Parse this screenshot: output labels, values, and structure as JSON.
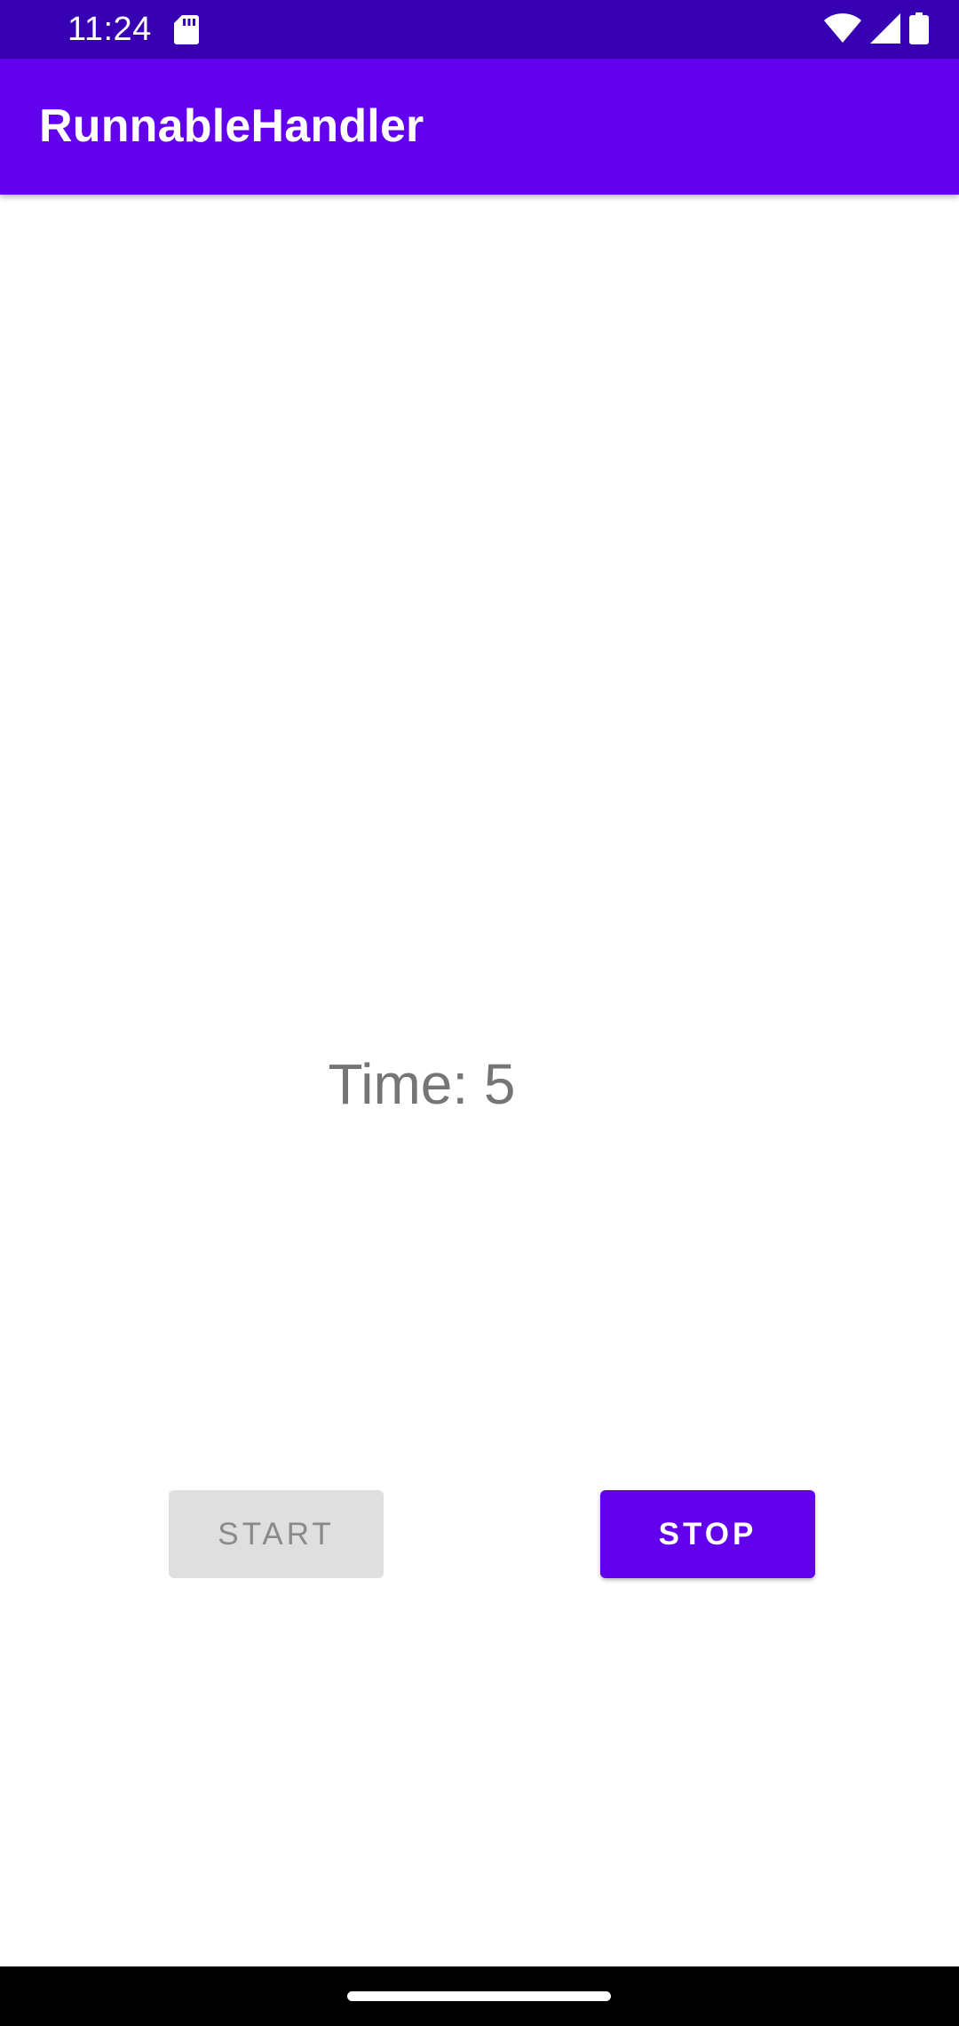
{
  "status_bar": {
    "time": "11:24",
    "icons": [
      "sd-card-icon",
      "wifi-icon",
      "signal-icon",
      "battery-icon"
    ],
    "background": "#3700b3"
  },
  "app_bar": {
    "title": "RunnableHandler",
    "background": "#6200ee"
  },
  "main": {
    "time_label": "Time: 5",
    "start_button": {
      "label": "START",
      "enabled": false
    },
    "stop_button": {
      "label": "STOP",
      "enabled": true
    }
  },
  "colors": {
    "primary": "#6200ee",
    "primary_dark": "#3700b3",
    "disabled_bg": "#dfdfdf",
    "disabled_text": "#8a8a8a",
    "text_secondary": "#757575"
  }
}
